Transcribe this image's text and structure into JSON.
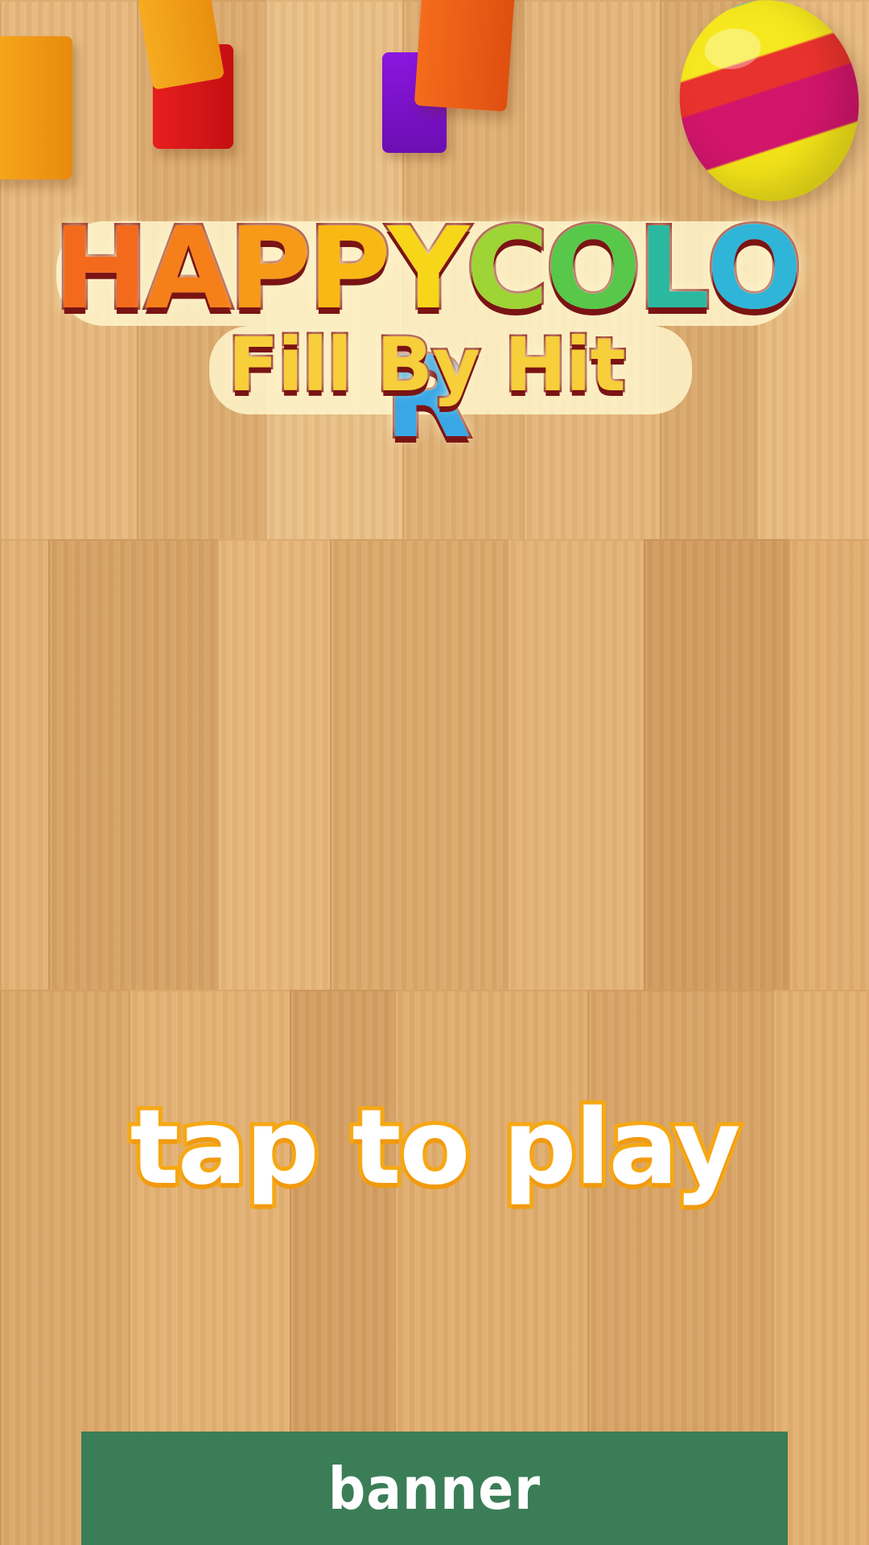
{
  "logo": {
    "title_letters": [
      {
        "ch": "H",
        "color": "#f46a1c"
      },
      {
        "ch": "A",
        "color": "#f57f19"
      },
      {
        "ch": "P",
        "color": "#f79a17"
      },
      {
        "ch": "P",
        "color": "#f9b914"
      },
      {
        "ch": "Y",
        "color": "#f7d61a"
      },
      {
        "ch": "C",
        "color": "#9ed435"
      },
      {
        "ch": "O",
        "color": "#57c84a"
      },
      {
        "ch": "L",
        "color": "#2ab9a0"
      },
      {
        "ch": "O",
        "color": "#2fb5d8"
      },
      {
        "ch": "R",
        "color": "#39a7e6"
      }
    ],
    "subtitle": "Fill By Hit"
  },
  "prompt": {
    "label": "tap to play"
  },
  "banner": {
    "label": "banner",
    "color": "#3b7d57"
  },
  "toys": [
    {
      "kind": "cube",
      "color": "#f29a13"
    },
    {
      "kind": "cube",
      "color": "#f3a21c"
    },
    {
      "kind": "cube",
      "color": "#e0161a"
    },
    {
      "kind": "cube",
      "color": "#7a12c8"
    },
    {
      "kind": "cube",
      "color": "#f0621a"
    },
    {
      "kind": "ball",
      "colors": [
        "#f6e81e",
        "#e8322d",
        "#d0156a",
        "#32b6e6"
      ]
    }
  ]
}
